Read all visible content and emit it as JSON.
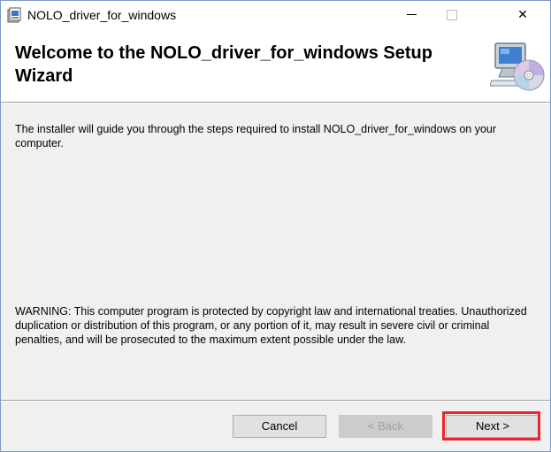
{
  "window": {
    "title": "NOLO_driver_for_windows",
    "controls": {
      "minimize_icon": "minimize-icon",
      "maximize_icon": "maximize-icon",
      "close_symbol": "✕"
    }
  },
  "banner": {
    "title": "Welcome to the NOLO_driver_for_windows Setup Wizard",
    "icon": "computer-cd-icon"
  },
  "body": {
    "intro": "The installer will guide you through the steps required to install NOLO_driver_for_windows on your computer.",
    "warning": "WARNING: This computer program is protected by copyright law and international treaties. Unauthorized duplication or distribution of this program, or any portion of it, may result in severe civil or criminal penalties, and will be prosecuted to the maximum extent possible under the law."
  },
  "buttons": {
    "cancel": "Cancel",
    "back": "< Back",
    "next": "Next >"
  },
  "colors": {
    "highlight": "#e8262d",
    "window_border": "#7a9cc6",
    "dialog_bg": "#f0f0f0"
  }
}
